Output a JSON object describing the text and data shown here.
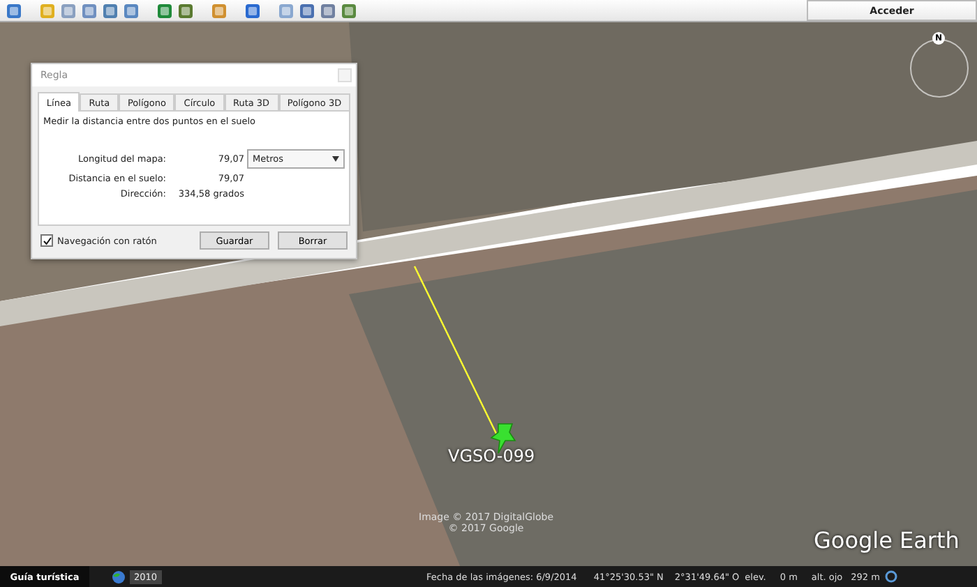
{
  "toolbar": {
    "account_button": "Acceder"
  },
  "dialog": {
    "title": "Regla",
    "tabs": [
      {
        "label": "Línea",
        "selected": true
      },
      {
        "label": "Ruta",
        "selected": false
      },
      {
        "label": "Polígono",
        "selected": false
      },
      {
        "label": "Círculo",
        "selected": false
      },
      {
        "label": "Ruta 3D",
        "selected": false
      },
      {
        "label": "Polígono 3D",
        "selected": false
      }
    ],
    "description": "Medir la distancia entre dos puntos en el suelo",
    "rows": [
      {
        "label": "Longitud del mapa:",
        "value": "79,07",
        "unit_select": "Metros"
      },
      {
        "label": "Distancia en el suelo:",
        "value": "79,07"
      },
      {
        "label": "Dirección:",
        "value": "334,58 grados"
      }
    ],
    "mouse_navigation": {
      "label": "Navegación con ratón",
      "checked": true
    },
    "buttons": [
      "Guardar",
      "Borrar"
    ]
  },
  "map": {
    "compass": "N",
    "placemark": "VGSO-099",
    "credits": [
      "Image © 2017 DigitalGlobe",
      "© 2017 Google"
    ],
    "logo": "Google Earth"
  },
  "status_bar": {
    "tour_button": "Guía turística",
    "year": "2010",
    "date": "Fecha de las imágenes: 6/9/2014",
    "latitude": "41°25'30.53\" N",
    "longitude": "2°31'49.64\" O",
    "elevation_label": "elev.",
    "elevation": "0 m",
    "eye_label": "alt. ojo",
    "eye_altitude": "292 m"
  }
}
